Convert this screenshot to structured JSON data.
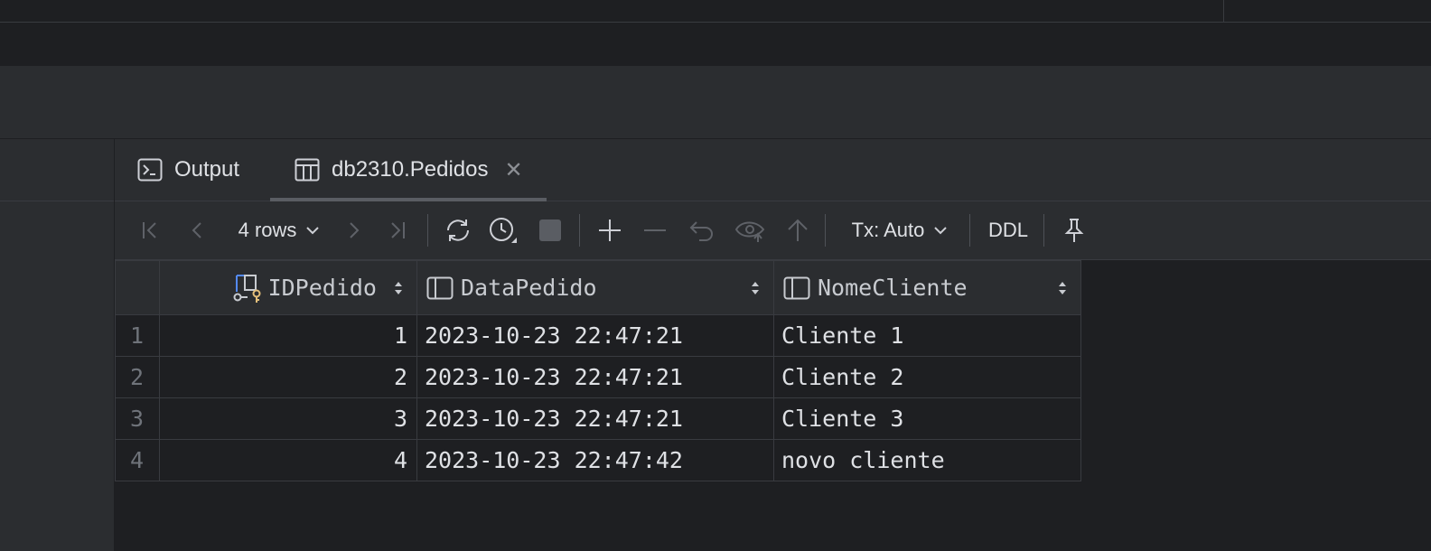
{
  "tabs": [
    {
      "label": "Output",
      "icon": "terminal-icon"
    },
    {
      "label": "db2310.Pedidos",
      "icon": "table-icon",
      "close": "✕"
    }
  ],
  "toolbar": {
    "rows_label": "4 rows",
    "tx_label": "Tx: Auto",
    "ddl_label": "DDL"
  },
  "grid": {
    "columns": [
      "IDPedido",
      "DataPedido",
      "NomeCliente"
    ],
    "rows": [
      {
        "n": "1",
        "id": "1",
        "date": "2023-10-23 22:47:21",
        "name": "Cliente 1"
      },
      {
        "n": "2",
        "id": "2",
        "date": "2023-10-23 22:47:21",
        "name": "Cliente 2"
      },
      {
        "n": "3",
        "id": "3",
        "date": "2023-10-23 22:47:21",
        "name": "Cliente 3"
      },
      {
        "n": "4",
        "id": "4",
        "date": "2023-10-23 22:47:42",
        "name": "novo cliente"
      }
    ]
  },
  "colors": {
    "background": "#1e1f22",
    "panel": "#2b2d30",
    "border": "#393b40",
    "key_accent": "#e5c07b",
    "fk_accent": "#548af7"
  }
}
